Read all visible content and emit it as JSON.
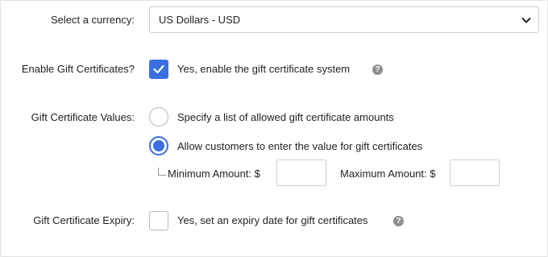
{
  "currency": {
    "label": "Select a currency:",
    "selected": "US Dollars - USD",
    "chevron_icon": "chevron-down-icon"
  },
  "gift_certificates": {
    "label": "Enable Gift Certificates?",
    "checkbox_text": "Yes, enable the gift certificate system",
    "checked": true
  },
  "values": {
    "label": "Gift Certificate Values:",
    "option_list": "Specify a list of allowed gift certificate amounts",
    "option_custom": "Allow customers to enter the value for gift certificates",
    "selected_option": "option_custom",
    "min_label": "Minimum Amount: $",
    "min_value": "",
    "max_label": "Maximum Amount: $",
    "max_value": ""
  },
  "expiry": {
    "label": "Gift Certificate Expiry:",
    "checkbox_text": "Yes, set an expiry date for gift certificates",
    "checked": false
  },
  "help_icon_glyph": "?",
  "colors": {
    "accent": "#3b6fe0",
    "border": "#cfcfcf",
    "help": "#8f8f8f"
  }
}
